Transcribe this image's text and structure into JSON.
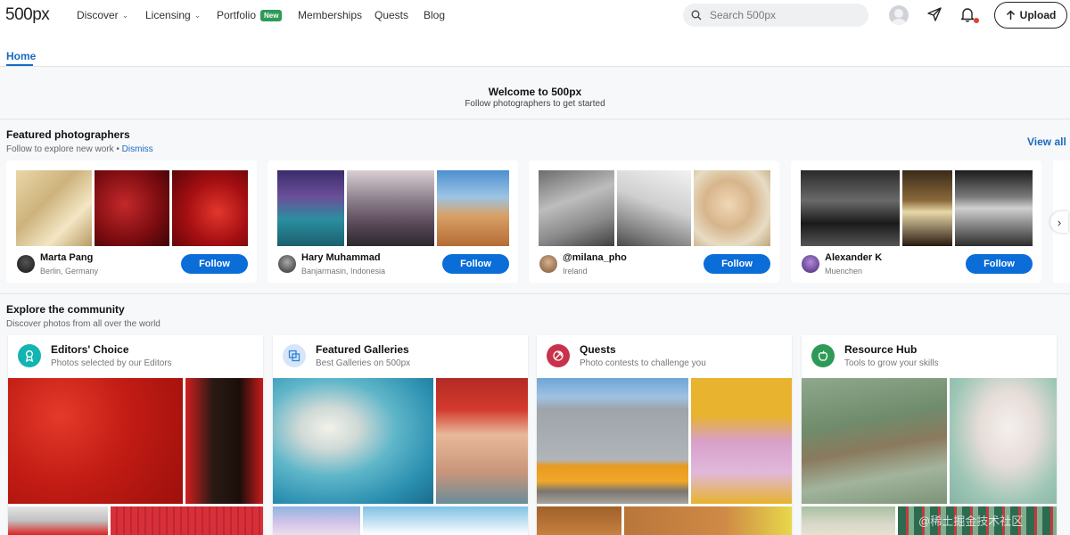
{
  "header": {
    "logo": "500px",
    "nav": [
      {
        "label": "Discover",
        "has_dropdown": true
      },
      {
        "label": "Licensing",
        "has_dropdown": true
      },
      {
        "label": "Portfolio",
        "badge": "New"
      },
      {
        "label": "Memberships"
      },
      {
        "label": "Quests"
      },
      {
        "label": "Blog"
      }
    ],
    "search_placeholder": "Search 500px",
    "upload_label": "Upload",
    "icons": [
      "search-icon",
      "avatar",
      "send-icon",
      "bell-icon",
      "upload-arrow-icon"
    ]
  },
  "tabs": [
    {
      "label": "Home",
      "active": true
    }
  ],
  "welcome": {
    "title": "Welcome to 500px",
    "subtitle": "Follow photographers to get started"
  },
  "featured": {
    "title": "Featured photographers",
    "subtitle": "Follow to explore new work •",
    "dismiss": "Dismiss",
    "view_all": "View all",
    "follow_label": "Follow",
    "photographers": [
      {
        "name": "Marta Pang",
        "location": "Berlin, Germany"
      },
      {
        "name": "Hary Muhammad",
        "location": "Banjarmasin, Indonesia"
      },
      {
        "name": "@milana_pho",
        "location": "Ireland"
      },
      {
        "name": "Alexander K",
        "location": "Muenchen"
      }
    ]
  },
  "community": {
    "title": "Explore the community",
    "subtitle": "Discover photos from all over the world",
    "cards": [
      {
        "title": "Editors' Choice",
        "subtitle": "Photos selected by our Editors",
        "icon": "ribbon-icon",
        "color": "#12b5b0"
      },
      {
        "title": "Featured Galleries",
        "subtitle": "Best Galleries on 500px",
        "icon": "gallery-icon",
        "color": "#2f80d6"
      },
      {
        "title": "Quests",
        "subtitle": "Photo contests to challenge you",
        "icon": "quest-icon",
        "color": "#c8324a"
      },
      {
        "title": "Resource Hub",
        "subtitle": "Tools to grow your skills",
        "icon": "apple-icon",
        "color": "#2e9a57"
      }
    ]
  },
  "watermark": "@稀土掘金技术社区",
  "colors": {
    "accent": "#0b6dd8",
    "link": "#1a6bc1",
    "new_badge": "#2e9a57"
  }
}
